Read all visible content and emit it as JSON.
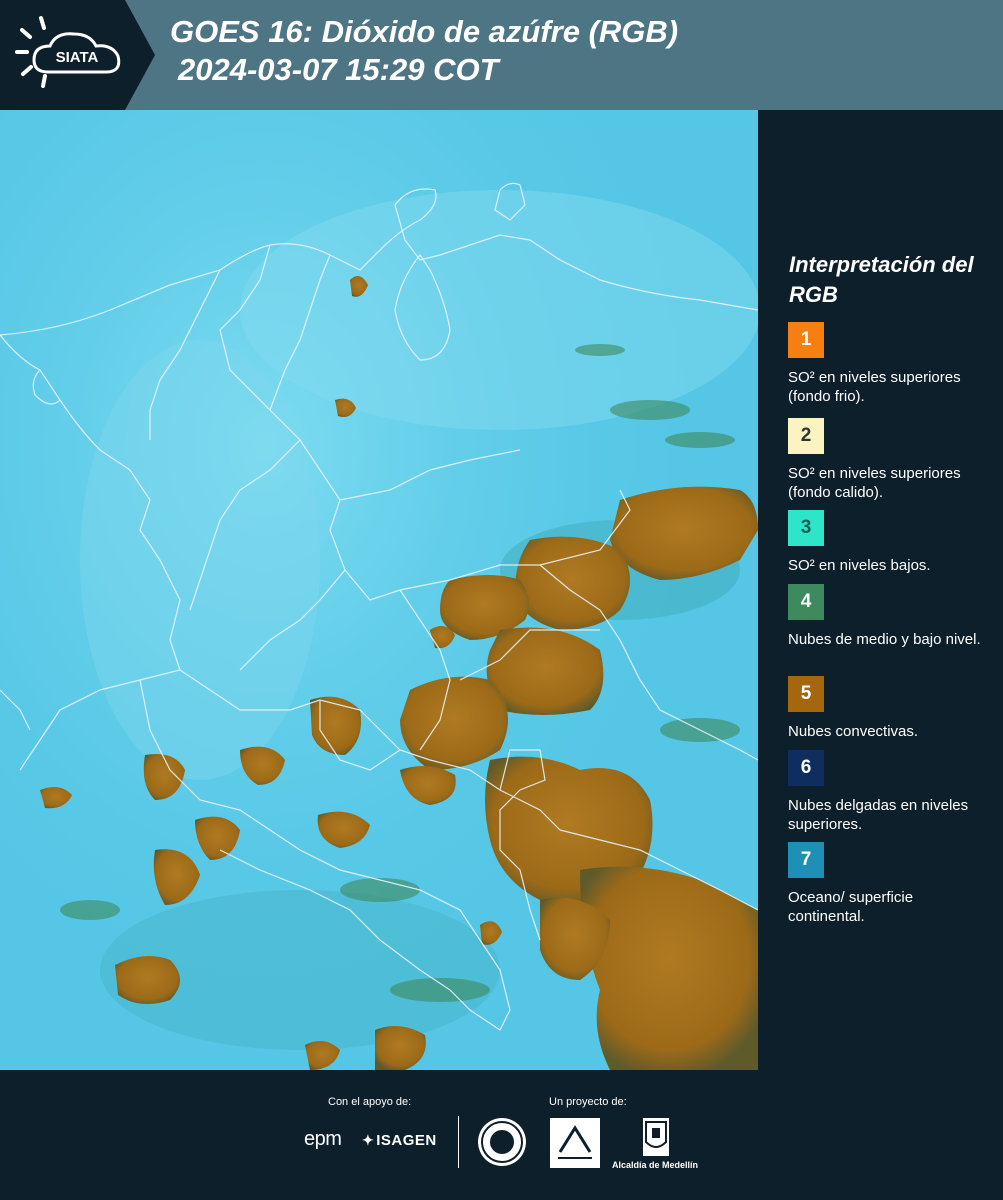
{
  "header": {
    "logo_text": "SIATA",
    "title_line1": "GOES 16: Dióxido de azúfre (RGB)",
    "title_line2": "2024-03-07 15:29 COT"
  },
  "map": {
    "image": "GOES 16 sulfur dioxide RGB composite over Colombia",
    "background_color": "#5ccbe8",
    "cloud_color": "#a8741d",
    "border_color": "#e8f4f8"
  },
  "legend": {
    "title": "Interpretación del RGB",
    "items": [
      {
        "number": "1",
        "color": "#f57f11",
        "text_color": "#ffffff",
        "label": "SO² en niveles superiores (fondo frio)."
      },
      {
        "number": "2",
        "color": "#fbf4c2",
        "text_color": "#333333",
        "label": "SO² en niveles superiores (fondo calido)."
      },
      {
        "number": "3",
        "color": "#2de5c9",
        "text_color": "#1d5e57",
        "label": "SO² en niveles bajos."
      },
      {
        "number": "4",
        "color": "#3c8a5e",
        "text_color": "#ffffff",
        "label": "Nubes de medio y bajo nivel."
      },
      {
        "number": "5",
        "color": "#a5670d",
        "text_color": "#ffffff",
        "label": "Nubes convectivas."
      },
      {
        "number": "6",
        "color": "#0f2d5e",
        "text_color": "#ffffff",
        "label": "Nubes delgadas en niveles superiores."
      },
      {
        "number": "7",
        "color": "#1e90b5",
        "text_color": "#ffffff",
        "label": "Oceano/ superficie continental."
      }
    ]
  },
  "footer": {
    "support_label": "Con el apoyo de:",
    "project_label": "Un proyecto de:",
    "sponsors": [
      "epm",
      "ISAGEN"
    ],
    "alcaldia_label": "Alcaldía de Medellín"
  }
}
